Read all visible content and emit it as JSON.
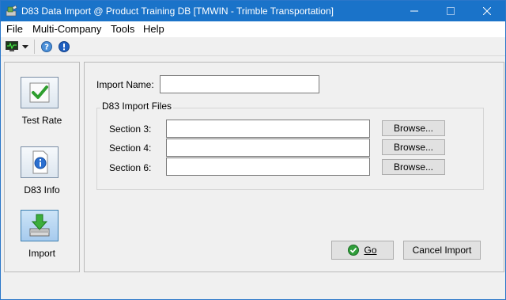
{
  "window": {
    "title": "D83 Data Import @ Product Training DB [TMWIN - Trimble Transportation]",
    "accent": "#1a73c9"
  },
  "menu": [
    "File",
    "Multi-Company",
    "Tools",
    "Help"
  ],
  "toolbar": {
    "icons": [
      "monitor-icon",
      "dropdown-arrow-icon",
      "help-icon",
      "info-icon"
    ]
  },
  "sidebar": {
    "items": [
      {
        "label": "Test Rate",
        "icon": "checkmark-icon"
      },
      {
        "label": "D83 Info",
        "icon": "info-document-icon"
      },
      {
        "label": "Import",
        "icon": "import-download-icon"
      }
    ]
  },
  "form": {
    "import_name_label": "Import Name:",
    "import_name_value": "",
    "group_title": "D83 Import Files",
    "sections": [
      {
        "label": "Section 3:",
        "value": "",
        "browse": "Browse..."
      },
      {
        "label": "Section 4:",
        "value": "",
        "browse": "Browse..."
      },
      {
        "label": "Section 6:",
        "value": "",
        "browse": "Browse..."
      }
    ],
    "go_label": "Go",
    "cancel_label": "Cancel Import"
  }
}
